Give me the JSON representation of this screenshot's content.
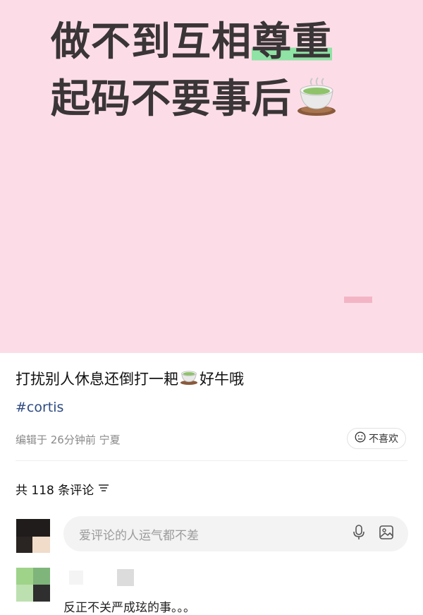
{
  "hero": {
    "line1_prefix": "做不到互相",
    "line1_highlight": "尊重",
    "line2": "起码不要事后",
    "line2_emoji": "tea-cup-icon",
    "background": "#fcdde7",
    "highlight_color": "#8fe3a4"
  },
  "post": {
    "title_before": "打扰别人休息还倒打一耙",
    "title_emoji": "tea-cup-icon",
    "title_after": "好牛哦",
    "hashtag": "#cortis",
    "meta": "编辑于 26分钟前 宁夏",
    "dislike_label": "不喜欢"
  },
  "comments": {
    "header": "共 118 条评论",
    "input_placeholder": "爱评论的人运气都不差",
    "items": [
      {
        "text": "反正不关严成玹的事。。。"
      }
    ]
  }
}
